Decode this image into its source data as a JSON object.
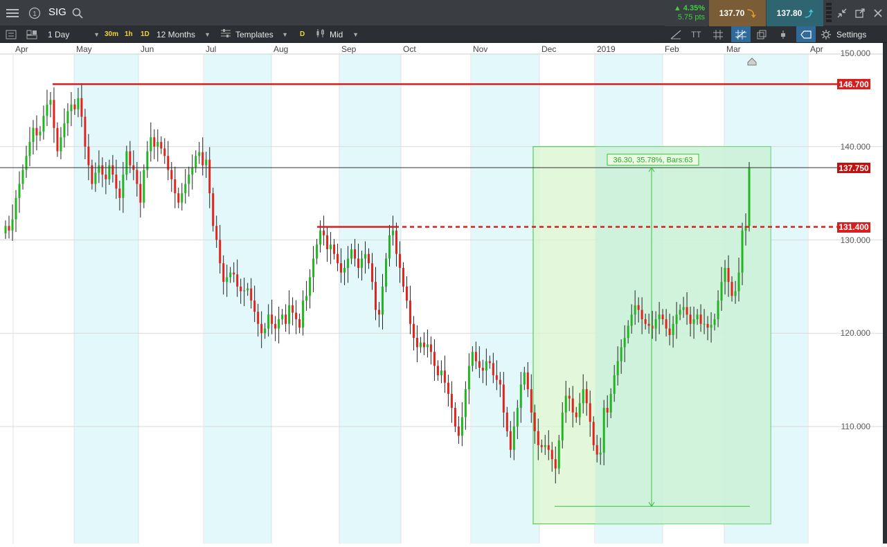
{
  "topbar": {
    "symbol": "SIG",
    "change_pct": "▲ 4.35%",
    "change_pts": "5.75 pts",
    "sell_price": "137.70",
    "buy_price": "137.80",
    "sell_arrow": "⤵",
    "buy_arrow": "⤴"
  },
  "toolbar": {
    "interval": "1 Day",
    "quick_30m": "30m",
    "quick_1h": "1h",
    "quick_1d": "1D",
    "range": "12 Months",
    "templates": "Templates",
    "draw_d": "D",
    "price_type": "Mid",
    "text_tool": "TT",
    "settings": "Settings"
  },
  "chart_data": {
    "type": "candlestick",
    "x_labels": [
      "Apr",
      "May",
      "Jun",
      "Jul",
      "Aug",
      "Sep",
      "Oct",
      "Nov",
      "Dec",
      "2019",
      "Feb",
      "Mar",
      "Apr"
    ],
    "y_ticks": [
      "110.000",
      "120.000",
      "130.000",
      "140.000",
      "150.000"
    ],
    "ylim": [
      103,
      150.5
    ],
    "grid": true,
    "price_tags": [
      {
        "label": "146.700",
        "value": 146.7,
        "color": "#d62020"
      },
      {
        "label": "137.750",
        "value": 137.75,
        "color": "#c01010"
      },
      {
        "label": "131.400",
        "value": 131.4,
        "color": "#d62020"
      }
    ],
    "measure": {
      "label": "36.30, 35.78%, Bars:63",
      "from": 101.45,
      "to": 137.75
    },
    "closes": [
      131.5,
      131.0,
      132.2,
      134.5,
      136.0,
      137.5,
      139.0,
      140.5,
      142.0,
      141.2,
      141.6,
      143.3,
      144.5,
      145.0,
      142.0,
      139.5,
      141.0,
      142.5,
      143.8,
      144.5,
      144.0,
      145.2,
      143.2,
      140.0,
      138.0,
      136.0,
      137.2,
      138.0,
      137.0,
      136.5,
      138.0,
      137.0,
      135.5,
      134.5,
      137.0,
      139.5,
      138.0,
      137.5,
      136.0,
      134.0,
      137.5,
      139.5,
      141.0,
      140.0,
      140.5,
      139.8,
      139.0,
      137.5,
      136.5,
      135.0,
      134.0,
      135.0,
      136.0,
      137.0,
      137.8,
      139.0,
      139.4,
      138.0,
      138.6,
      135.0,
      131.5,
      130.0,
      127.5,
      125.5,
      126.0,
      126.5,
      126.3,
      125.0,
      124.5,
      124.6,
      124.8,
      123.5,
      122.3,
      121.0,
      120.0,
      120.5,
      122.0,
      121.0,
      120.5,
      121.5,
      122.0,
      121.0,
      123.0,
      122.2,
      121.5,
      120.6,
      123.5,
      124.0,
      126.0,
      128.0,
      129.5,
      131.0,
      130.5,
      129.0,
      129.5,
      128.5,
      127.5,
      126.5,
      127.0,
      128.0,
      129.0,
      128.0,
      127.0,
      128.0,
      128.5,
      127.5,
      125.5,
      122.5,
      122.0,
      125.0,
      128.0,
      130.5,
      131.0,
      128.5,
      127.0,
      125.0,
      123.5,
      121.0,
      119.5,
      118.5,
      119.0,
      118.5,
      118.8,
      118.0,
      116.5,
      115.5,
      116.0,
      114.7,
      113.5,
      112.0,
      110.0,
      109.0,
      111.0,
      114.0,
      116.5,
      118.0,
      117.0,
      116.3,
      116.0,
      117.0,
      116.8,
      115.5,
      115.0,
      114.5,
      111.5,
      109.5,
      107.5,
      110.0,
      112.0,
      114.5,
      115.8,
      114.0,
      111.5,
      109.5,
      108.0,
      107.8,
      108.0,
      107.5,
      106.5,
      105.5,
      108.5,
      111.5,
      113.3,
      113.0,
      111.5,
      111.0,
      112.5,
      114.0,
      112.5,
      110.5,
      108.0,
      107.0,
      107.2,
      112.0,
      111.5,
      113.5,
      115.5,
      117.0,
      118.5,
      119.5,
      120.8,
      122.0,
      123.0,
      122.5,
      121.5,
      121.0,
      120.8,
      120.5,
      121.5,
      122.0,
      121.5,
      120.5,
      119.8,
      121.0,
      122.0,
      122.5,
      122.8,
      122.0,
      121.0,
      121.5,
      122.0,
      121.0,
      121.0,
      120.6,
      120.9,
      121.5,
      123.5,
      125.5,
      127.0,
      125.5,
      124.0,
      124.5,
      126.5,
      131.0,
      131.5,
      137.75
    ]
  }
}
